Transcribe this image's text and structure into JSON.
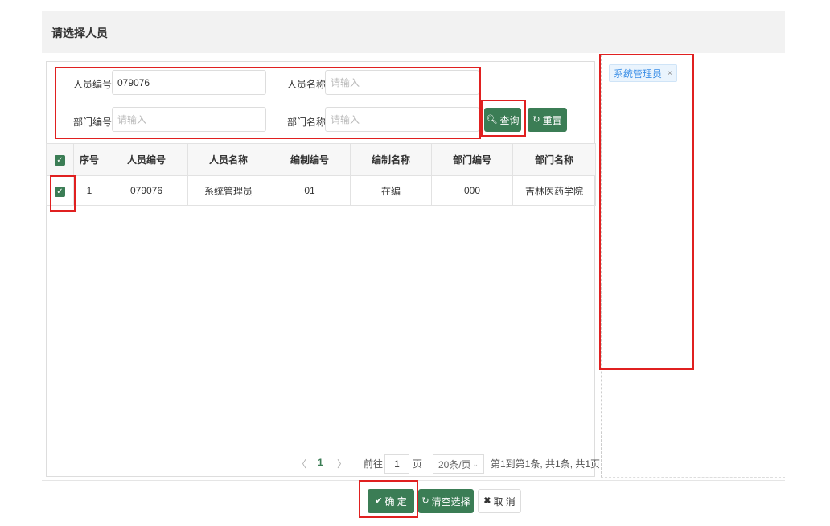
{
  "dialog": {
    "title": "请选择人员"
  },
  "search": {
    "person_code_label": "人员编号",
    "person_code_value": "079076",
    "person_name_label": "人员名称",
    "person_name_placeholder": "请输入",
    "dept_code_label": "部门编号",
    "dept_code_placeholder": "请输入",
    "dept_name_label": "部门名称",
    "dept_name_placeholder": "请输入",
    "query_label": "查询",
    "reset_label": "重置"
  },
  "table": {
    "columns": [
      "序号",
      "人员编号",
      "人员名称",
      "编制编号",
      "编制名称",
      "部门编号",
      "部门名称"
    ],
    "rows": [
      {
        "checked": true,
        "cells": [
          "1",
          "079076",
          "系统管理员",
          "01",
          "在编",
          "000",
          "吉林医药学院"
        ]
      }
    ]
  },
  "pagination": {
    "prev": "〈",
    "current_page": "1",
    "next": "〉",
    "goto_label": "前往",
    "goto_value": "1",
    "page_unit": "页",
    "page_size": "20条/页",
    "summary": "第1到第1条, 共1条, 共1页"
  },
  "selected": [
    {
      "label": "系统管理员",
      "close": "×"
    }
  ],
  "footer": {
    "confirm_label": "确 定",
    "clear_label": "清空选择",
    "cancel_label": "取 消"
  },
  "colors": {
    "primary_green": "#3b7d55",
    "tag_blue": "#3a8ee6",
    "highlight_red": "#e02020"
  }
}
